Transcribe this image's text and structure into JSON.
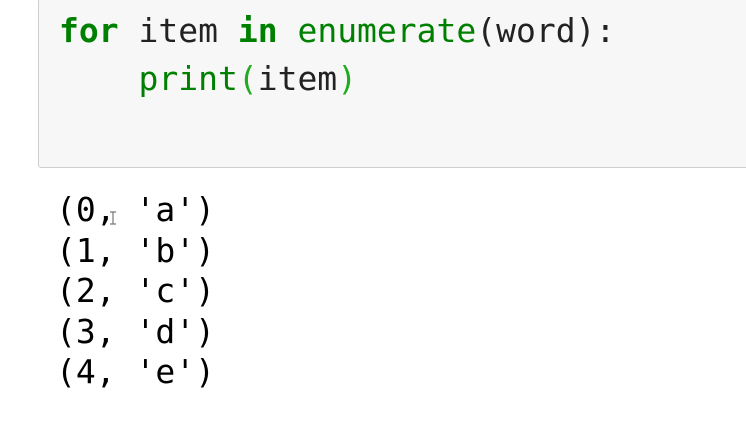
{
  "code_cell": {
    "line1": {
      "kw_for": "for",
      "sp1": " item ",
      "kw_in": "in",
      "sp2": " ",
      "fn_enumerate": "enumerate",
      "args": "(word):"
    },
    "line2": {
      "indent": "    ",
      "fn_print": "print",
      "open_paren": "(",
      "arg": "item",
      "close_paren": ")"
    }
  },
  "output": {
    "lines": [
      "(0, 'a')",
      "(1, 'b')",
      "(2, 'c')",
      "(3, 'd')",
      "(4, 'e')"
    ]
  },
  "colors": {
    "keyword": "#008000",
    "builtin": "#008000",
    "matched_paren": "#22aa22",
    "cell_background": "#f7f7f7"
  },
  "cursor": {
    "icon": "text-cursor-icon"
  }
}
